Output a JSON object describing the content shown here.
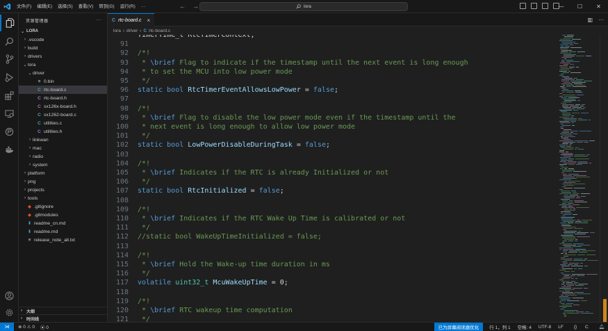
{
  "titlebar": {
    "menus": [
      "文件(F)",
      "编辑(E)",
      "选择(S)",
      "查看(V)",
      "转到(G)",
      "运行(R)",
      "···"
    ],
    "search_text": "lora",
    "back_glyph": "←",
    "forward_glyph": "→"
  },
  "sidebar": {
    "title": "资源管理器",
    "more": "···",
    "root": "LORA",
    "items": [
      {
        "label": ".vscode",
        "type": "folder",
        "depth": 1,
        "expanded": false
      },
      {
        "label": "build",
        "type": "folder",
        "depth": 1,
        "expanded": false
      },
      {
        "label": "drivers",
        "type": "folder",
        "depth": 1,
        "expanded": false
      },
      {
        "label": "lora",
        "type": "folder",
        "depth": 1,
        "expanded": true
      },
      {
        "label": "driver",
        "type": "folder",
        "depth": 2,
        "expanded": true
      },
      {
        "label": "0.bin",
        "type": "bin",
        "depth": 3
      },
      {
        "label": "rtc-board.c",
        "type": "c",
        "depth": 3,
        "selected": true
      },
      {
        "label": "rtc-board.h",
        "type": "h",
        "depth": 3
      },
      {
        "label": "sx126x-board.h",
        "type": "h",
        "depth": 3
      },
      {
        "label": "sx1262-board.c",
        "type": "c",
        "depth": 3
      },
      {
        "label": "utilities.c",
        "type": "c",
        "depth": 3
      },
      {
        "label": "utilities.h",
        "type": "h",
        "depth": 3
      },
      {
        "label": "linkwan",
        "type": "folder",
        "depth": 2,
        "expanded": false
      },
      {
        "label": "mac",
        "type": "folder",
        "depth": 2,
        "expanded": false
      },
      {
        "label": "radio",
        "type": "folder",
        "depth": 2,
        "expanded": false
      },
      {
        "label": "system",
        "type": "folder",
        "depth": 2,
        "expanded": false
      },
      {
        "label": "platform",
        "type": "folder",
        "depth": 1,
        "expanded": false
      },
      {
        "label": "png",
        "type": "folder",
        "depth": 1,
        "expanded": false
      },
      {
        "label": "projects",
        "type": "folder",
        "depth": 1,
        "expanded": false
      },
      {
        "label": "tools",
        "type": "folder",
        "depth": 1,
        "expanded": false
      },
      {
        "label": ".gitignore",
        "type": "git",
        "depth": 1
      },
      {
        "label": ".gitmodules",
        "type": "git",
        "depth": 1
      },
      {
        "label": "readme_cn.md",
        "type": "md",
        "depth": 1
      },
      {
        "label": "readme.md",
        "type": "md",
        "depth": 1
      },
      {
        "label": "release_note_all.txt",
        "type": "txt",
        "depth": 1
      }
    ],
    "outline_label": "大纲",
    "timeline_label": "时间线"
  },
  "editor": {
    "tab_label": "rtc-board.c",
    "tab_badge": "C",
    "close_glyph": "×",
    "breadcrumb": [
      "lora",
      "driver",
      "rtc-board.c"
    ],
    "lines": [
      {
        "n": "",
        "tokens": [
          [
            "plain",
            "TimerTime_t RtcTimerContext;"
          ]
        ]
      },
      {
        "n": "91",
        "tokens": []
      },
      {
        "n": "92",
        "tokens": [
          [
            "comment",
            "/*!"
          ]
        ]
      },
      {
        "n": "93",
        "tokens": [
          [
            "comment",
            " * "
          ],
          [
            "tag",
            "\\brief"
          ],
          [
            "comment",
            " Flag to indicate if the timestamp until the next event is long enough"
          ]
        ]
      },
      {
        "n": "94",
        "tokens": [
          [
            "comment",
            " * to set the MCU into low power mode"
          ]
        ]
      },
      {
        "n": "95",
        "tokens": [
          [
            "comment",
            " */"
          ]
        ]
      },
      {
        "n": "96",
        "tokens": [
          [
            "keyword",
            "static"
          ],
          [
            "plain",
            " "
          ],
          [
            "keyword",
            "bool"
          ],
          [
            "plain",
            " "
          ],
          [
            "ident",
            "RtcTimerEventAllowsLowPower"
          ],
          [
            "plain",
            " = "
          ],
          [
            "const",
            "false"
          ],
          [
            "plain",
            ";"
          ]
        ]
      },
      {
        "n": "97",
        "tokens": []
      },
      {
        "n": "98",
        "tokens": [
          [
            "comment",
            "/*!"
          ]
        ]
      },
      {
        "n": "99",
        "tokens": [
          [
            "comment",
            " * "
          ],
          [
            "tag",
            "\\brief"
          ],
          [
            "comment",
            " Flag to disable the low power mode even if the timestamp until the"
          ]
        ]
      },
      {
        "n": "100",
        "tokens": [
          [
            "comment",
            " * next event is long enough to allow low power mode"
          ]
        ]
      },
      {
        "n": "101",
        "tokens": [
          [
            "comment",
            " */"
          ]
        ]
      },
      {
        "n": "102",
        "tokens": [
          [
            "keyword",
            "static"
          ],
          [
            "plain",
            " "
          ],
          [
            "keyword",
            "bool"
          ],
          [
            "plain",
            " "
          ],
          [
            "ident",
            "LowPowerDisableDuringTask"
          ],
          [
            "plain",
            " = "
          ],
          [
            "const",
            "false"
          ],
          [
            "plain",
            ";"
          ]
        ]
      },
      {
        "n": "103",
        "tokens": []
      },
      {
        "n": "104",
        "tokens": [
          [
            "comment",
            "/*!"
          ]
        ]
      },
      {
        "n": "105",
        "tokens": [
          [
            "comment",
            " * "
          ],
          [
            "tag",
            "\\brief"
          ],
          [
            "comment",
            " Indicates if the RTC is already Initialized or not"
          ]
        ]
      },
      {
        "n": "106",
        "tokens": [
          [
            "comment",
            " */"
          ]
        ]
      },
      {
        "n": "107",
        "tokens": [
          [
            "keyword",
            "static"
          ],
          [
            "plain",
            " "
          ],
          [
            "keyword",
            "bool"
          ],
          [
            "plain",
            " "
          ],
          [
            "ident",
            "RtcInitialized"
          ],
          [
            "plain",
            " = "
          ],
          [
            "const",
            "false"
          ],
          [
            "plain",
            ";"
          ]
        ]
      },
      {
        "n": "108",
        "tokens": []
      },
      {
        "n": "109",
        "tokens": [
          [
            "comment",
            "/*!"
          ]
        ]
      },
      {
        "n": "110",
        "tokens": [
          [
            "comment",
            " * "
          ],
          [
            "tag",
            "\\brief"
          ],
          [
            "comment",
            " Indicates if the RTC Wake Up Time is calibrated or not"
          ]
        ]
      },
      {
        "n": "111",
        "tokens": [
          [
            "comment",
            " */"
          ]
        ]
      },
      {
        "n": "112",
        "tokens": [
          [
            "comment",
            "//static bool WakeUpTimeInitialized = false;"
          ]
        ]
      },
      {
        "n": "113",
        "tokens": []
      },
      {
        "n": "114",
        "tokens": [
          [
            "comment",
            "/*!"
          ]
        ]
      },
      {
        "n": "115",
        "tokens": [
          [
            "comment",
            " * "
          ],
          [
            "tag",
            "\\brief"
          ],
          [
            "comment",
            " Hold the Wake-up time duration in ms"
          ]
        ]
      },
      {
        "n": "116",
        "tokens": [
          [
            "comment",
            " */"
          ]
        ]
      },
      {
        "n": "117",
        "tokens": [
          [
            "keyword",
            "volatile"
          ],
          [
            "plain",
            " "
          ],
          [
            "type",
            "uint32_t"
          ],
          [
            "plain",
            " "
          ],
          [
            "ident",
            "McuWakeUpTime"
          ],
          [
            "plain",
            " = "
          ],
          [
            "plain",
            "0;"
          ]
        ]
      },
      {
        "n": "118",
        "tokens": []
      },
      {
        "n": "119",
        "tokens": [
          [
            "comment",
            "/*!"
          ]
        ]
      },
      {
        "n": "120",
        "tokens": [
          [
            "comment",
            " * "
          ],
          [
            "tag",
            "\\brief"
          ],
          [
            "comment",
            " RTC wakeup time computation"
          ]
        ]
      },
      {
        "n": "121",
        "tokens": [
          [
            "comment",
            " */"
          ]
        ]
      }
    ]
  },
  "statusbar": {
    "errors": "0",
    "warnings": "0",
    "ports": "0",
    "accessibility": "已为屏幕阅读器优化",
    "position": "行 1，列 1",
    "spaces": "空格: 4",
    "encoding": "UTF-8",
    "eol": "LF",
    "language": "C"
  },
  "colors": {
    "accent": "#0078d4",
    "comment": "#6a9955",
    "keyword": "#569cd6",
    "ident": "#9cdcfe",
    "type": "#4ec9b0",
    "c_file": "#519aba",
    "h_file": "#a074c4"
  }
}
